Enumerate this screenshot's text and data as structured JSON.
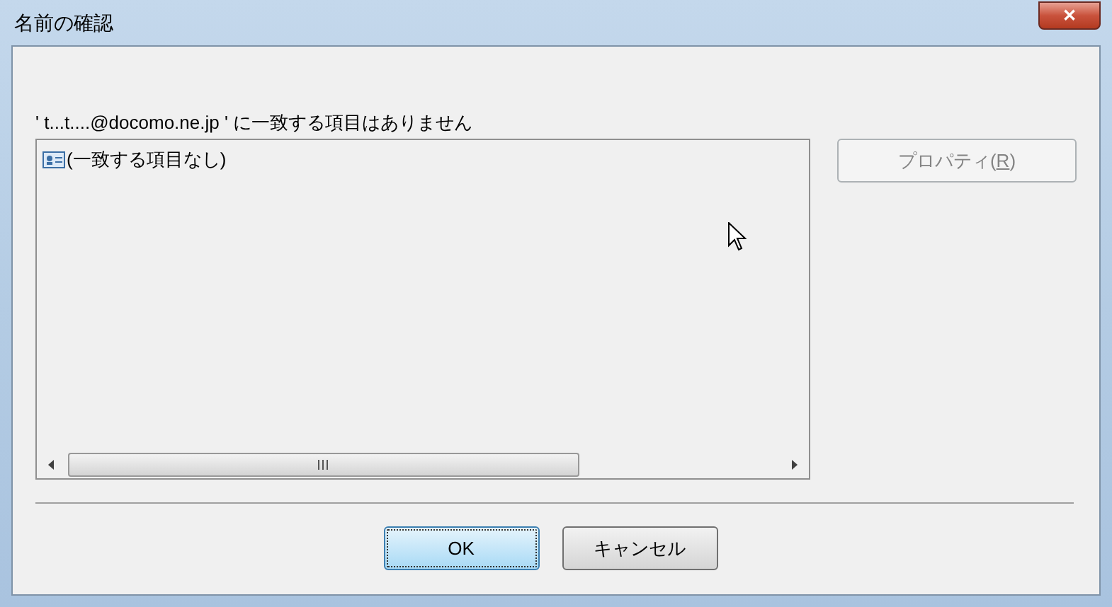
{
  "window": {
    "title": "名前の確認",
    "close": "✕"
  },
  "message": "' t...t....@docomo.ne.jp ' に一致する項目はありません",
  "list": {
    "items": [
      {
        "label": "(一致する項目なし)",
        "selected": false
      }
    ]
  },
  "properties_button": {
    "label_before": "プロパティ(",
    "mnemonic": "R",
    "label_after": ")",
    "disabled": true
  },
  "buttons": [
    {
      "label": "OK",
      "default": true
    },
    {
      "label": "キャンセル",
      "default": false
    }
  ]
}
